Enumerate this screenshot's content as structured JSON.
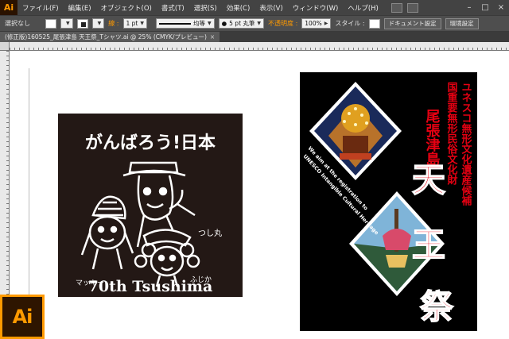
{
  "app": {
    "logo": "Ai"
  },
  "menu": {
    "items": [
      "ファイル(F)",
      "編集(E)",
      "オブジェクト(O)",
      "書式(T)",
      "選択(S)",
      "効果(C)",
      "表示(V)",
      "ウィンドウ(W)",
      "ヘルプ(H)"
    ]
  },
  "control": {
    "selection": "選択なし",
    "stroke_label": "線 :",
    "stroke_weight": "1 pt",
    "stroke_style": "均等",
    "brush": "5 pt 丸筆",
    "opacity_label": "不透明度 :",
    "opacity": "100%",
    "style_label": "スタイル :",
    "document_setup": "ドキュメント設定",
    "preferences": "環境設定"
  },
  "tab": {
    "title": "(修正版)160525_尾張津島 天王祭_Tシャツ.ai @ 25% (CMYK/プレビュー)",
    "close": "×"
  },
  "design1": {
    "heading": "がんばろう!日本",
    "char_right": "つし丸",
    "char_left": "マッキー",
    "char_bottom": "ふじか",
    "footer": "70th Tsushima"
  },
  "poster": {
    "line1": "ユネスコ無形文化遺産候補",
    "line2": "国重要無形民俗文化財",
    "line3": "尾張津島",
    "big1": "天",
    "big2": "王",
    "big3": "祭",
    "side_text1": "We aim at the registration to",
    "side_text2": "UNESCO Intangible Cultural Heritage"
  },
  "badge": {
    "label": "Ai"
  },
  "colors": {
    "accent": "#ff9a00",
    "poster_red": "#e60012",
    "design_bg": "#231815"
  }
}
